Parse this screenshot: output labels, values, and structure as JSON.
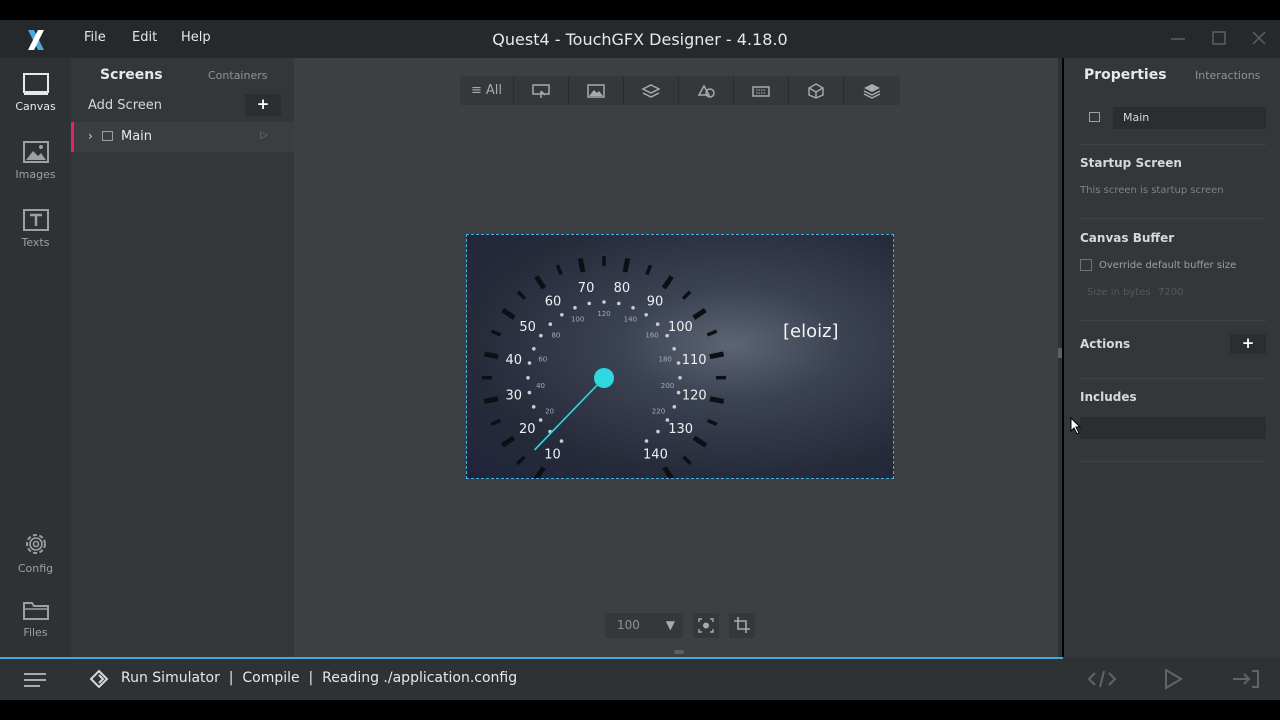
{
  "window": {
    "title": "Quest4 - TouchGFX Designer - 4.18.0",
    "menu": [
      "File",
      "Edit",
      "Help"
    ]
  },
  "rail": {
    "items": [
      {
        "label": "Canvas",
        "icon": "canvas-icon",
        "active": true
      },
      {
        "label": "Images",
        "icon": "images-icon",
        "active": false
      },
      {
        "label": "Texts",
        "icon": "texts-icon",
        "active": false
      },
      {
        "label": "Config",
        "icon": "gear-icon",
        "active": false
      },
      {
        "label": "Files",
        "icon": "folder-icon",
        "active": false
      }
    ]
  },
  "screens_panel": {
    "tabs": [
      "Screens",
      "Containers"
    ],
    "add_screen_label": "Add Screen",
    "add_button": "+",
    "screens": [
      {
        "name": "Main",
        "selected": true
      }
    ]
  },
  "canvas": {
    "filter_toolbar": {
      "all_label": "All",
      "icons": [
        "button-icon",
        "image-icon",
        "layers-icon",
        "shapes-icon",
        "keyboard-icon",
        "cube-icon",
        "stack-icon"
      ]
    },
    "gauge": {
      "outer_labels": [
        "10",
        "20",
        "30",
        "40",
        "50",
        "60",
        "70",
        "80",
        "90",
        "100",
        "110",
        "120",
        "130",
        "140"
      ],
      "inner_labels": [
        "20",
        "40",
        "60",
        "80",
        "100",
        "120",
        "140",
        "160",
        "180",
        "200",
        "220"
      ],
      "needle_color": "#2fd7e0"
    },
    "watermark": "[eloiz]",
    "zoom": "100"
  },
  "properties": {
    "tabs": [
      "Properties",
      "Interactions"
    ],
    "name_value": "Main",
    "startup_screen": {
      "title": "Startup Screen",
      "text": "This screen is startup screen"
    },
    "canvas_buffer": {
      "title": "Canvas Buffer",
      "override_label": "Override default buffer size",
      "override_checked": false,
      "size_label": "Size in bytes",
      "size_value": "7200"
    },
    "actions": {
      "title": "Actions",
      "add_button": "+"
    },
    "includes": {
      "title": "Includes"
    }
  },
  "statusbar": {
    "text": "Run Simulator  |  Compile  |  Reading ./application.config"
  },
  "colors": {
    "accent": "#3fa9e0",
    "selection": "#e0246f",
    "needle": "#2fd7e0"
  }
}
